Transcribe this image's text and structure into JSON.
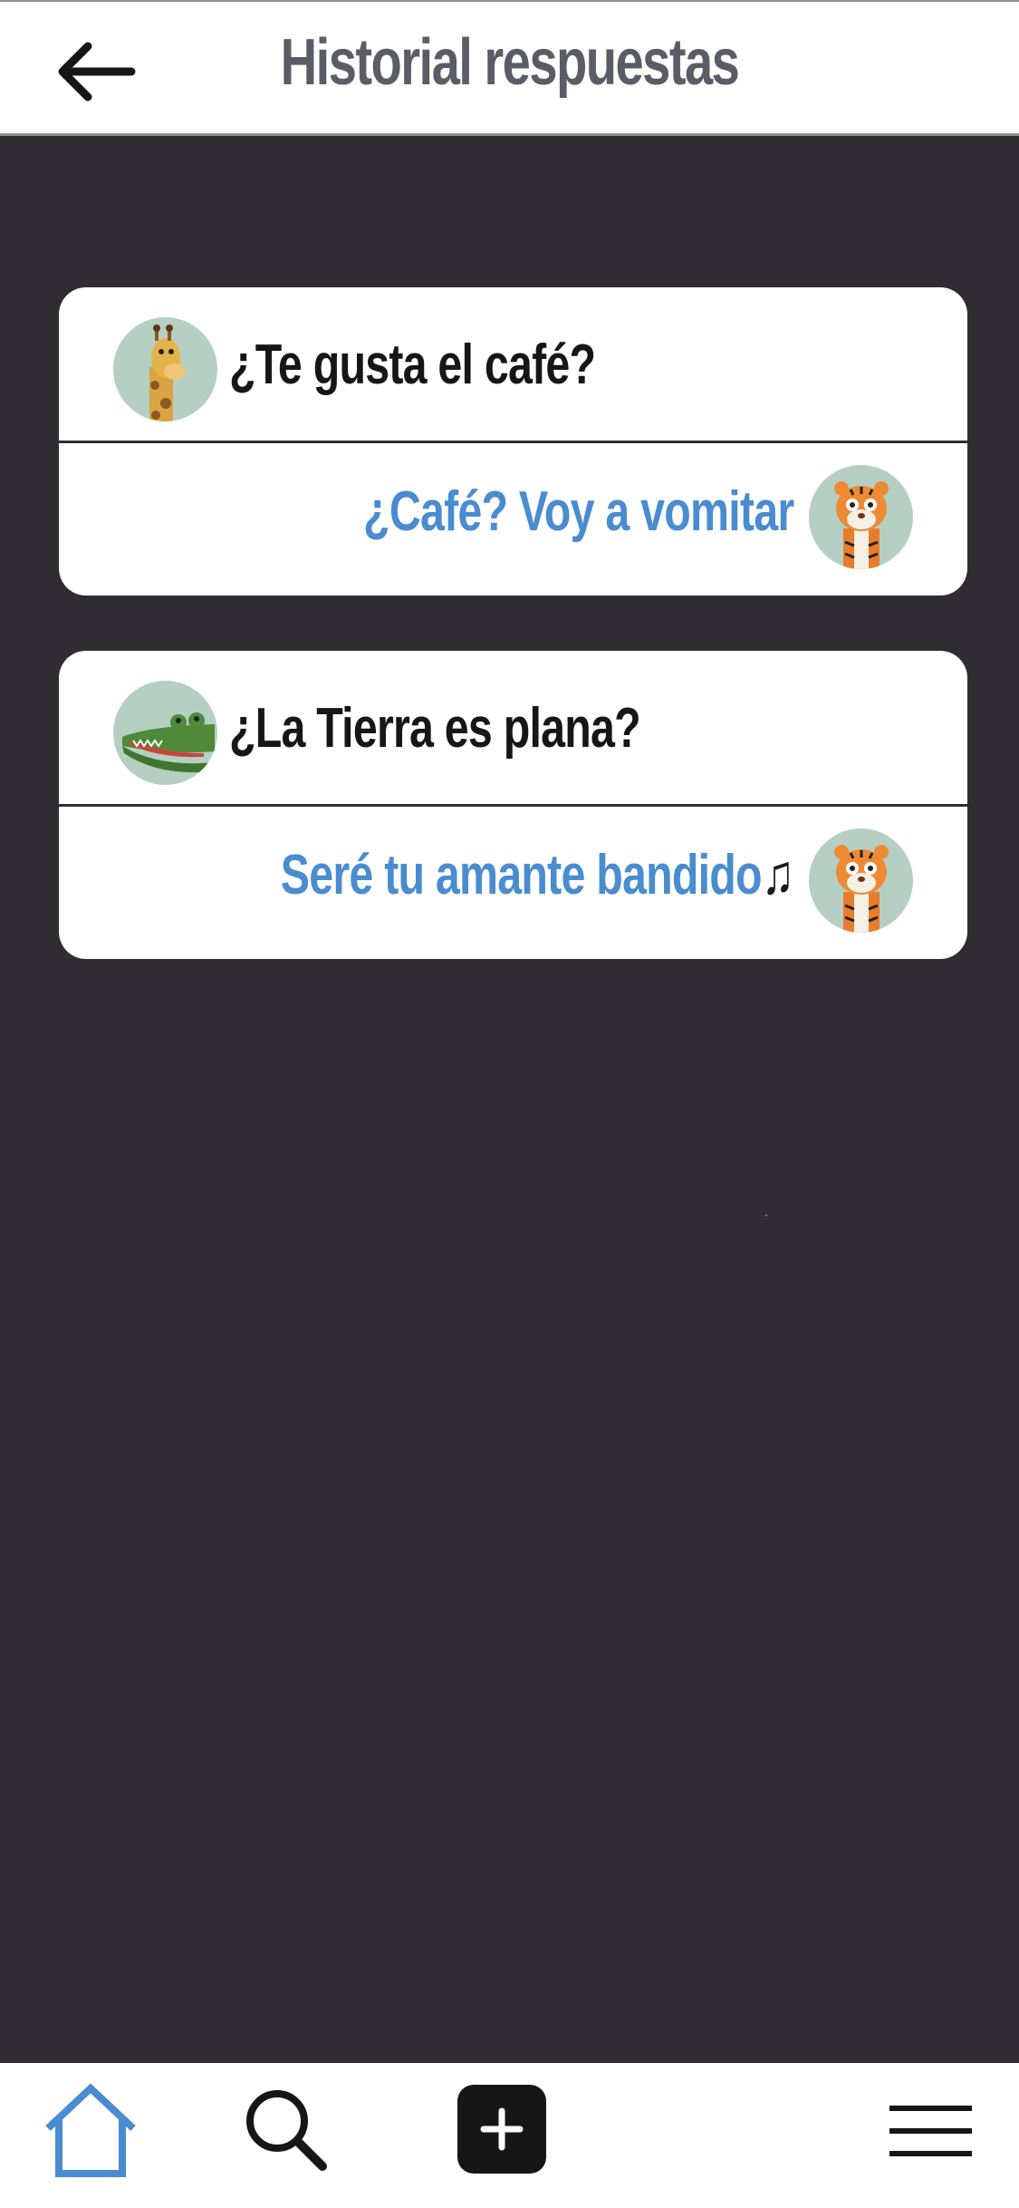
{
  "header": {
    "title": "Historial respuestas"
  },
  "cards": [
    {
      "question": "¿Te gusta el café?",
      "question_avatar": "giraffe-avatar",
      "answer": "¿Café? Voy a vomitar",
      "answer_avatar": "tiger-avatar"
    },
    {
      "question": "¿La Tierra es plana?",
      "question_avatar": "crocodile-avatar",
      "answer": "Seré tu amante bandido",
      "answer_extra": "♫",
      "answer_avatar": "tiger-avatar"
    }
  ],
  "nav": {
    "items": [
      "home-icon",
      "search-icon",
      "add-icon",
      "menu-icon"
    ]
  },
  "colors": {
    "background": "#2f2d33",
    "accent": "#4a8cd0",
    "avatar_bg": "#b5cfc3"
  }
}
